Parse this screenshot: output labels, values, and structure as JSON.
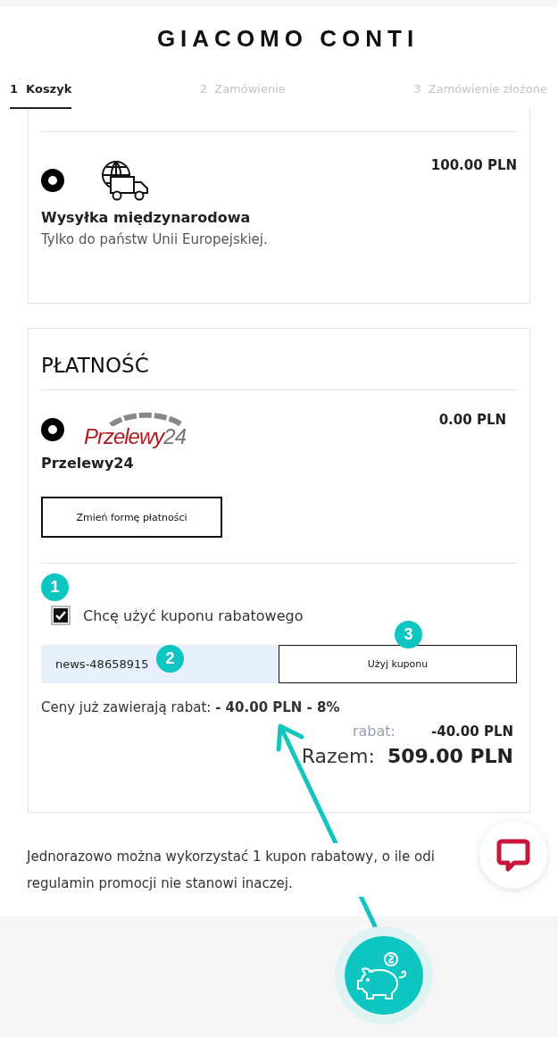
{
  "header": {
    "logo": "GIACOMO CONTI"
  },
  "steps": [
    {
      "number": "1",
      "label": "Koszyk",
      "selected": true
    },
    {
      "number": "2",
      "label": "Zamówienie",
      "selected": false
    },
    {
      "number": "3",
      "label": "Zamówienie złożone",
      "selected": false
    }
  ],
  "shipping": {
    "option": {
      "selected": true,
      "name": "Wysyłka międzynarodowa",
      "description": "Tylko do państw Unii Europejskiej.",
      "price": "100.00 PLN"
    }
  },
  "payment": {
    "title": "PŁATNOŚĆ",
    "option": {
      "selected": true,
      "logo": [
        "Przelewy",
        "24"
      ],
      "name": "Przelewy24",
      "price": "0.00 PLN"
    },
    "change_button": "Zmień formę płatności"
  },
  "coupon": {
    "checkbox": {
      "label": "Chcę użyć kuponu rabatowego",
      "checked": true
    },
    "code": "news-48658915",
    "apply_button": "Użyj kuponu",
    "note": "Ceny już zawierają rabat: **- 40.00 PLN - 8%**"
  },
  "totals": [
    {
      "label": "rabat:",
      "value": "-40.00 PLN",
      "kind": "discount"
    },
    {
      "label": "Razem:",
      "value": "509.00 PLN",
      "kind": "total"
    }
  ],
  "footnote": [
    "Jednorazowo można wykorzystać 1 kupon rabatowy, o ile odi",
    "regulamin promocji nie stanowi inaczej."
  ],
  "annotations": [
    {
      "number": "1"
    },
    {
      "number": "2"
    },
    {
      "number": "3"
    }
  ]
}
